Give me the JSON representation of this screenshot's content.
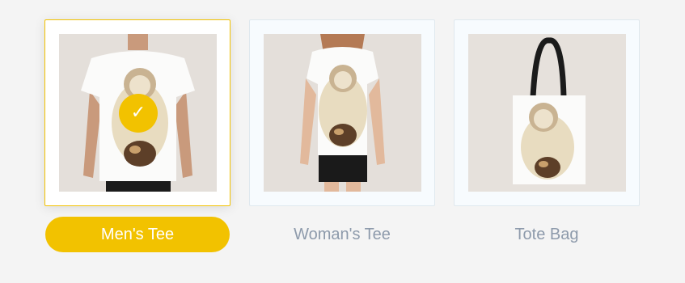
{
  "products": [
    {
      "label": "Men's Tee",
      "selected": true,
      "icon": "check-icon",
      "check": "✓"
    },
    {
      "label": "Woman's Tee",
      "selected": false
    },
    {
      "label": "Tote Bag",
      "selected": false
    }
  ],
  "colors": {
    "accent": "#f2c200",
    "label_text": "#8d9aab",
    "background": "#f4f4f4"
  }
}
